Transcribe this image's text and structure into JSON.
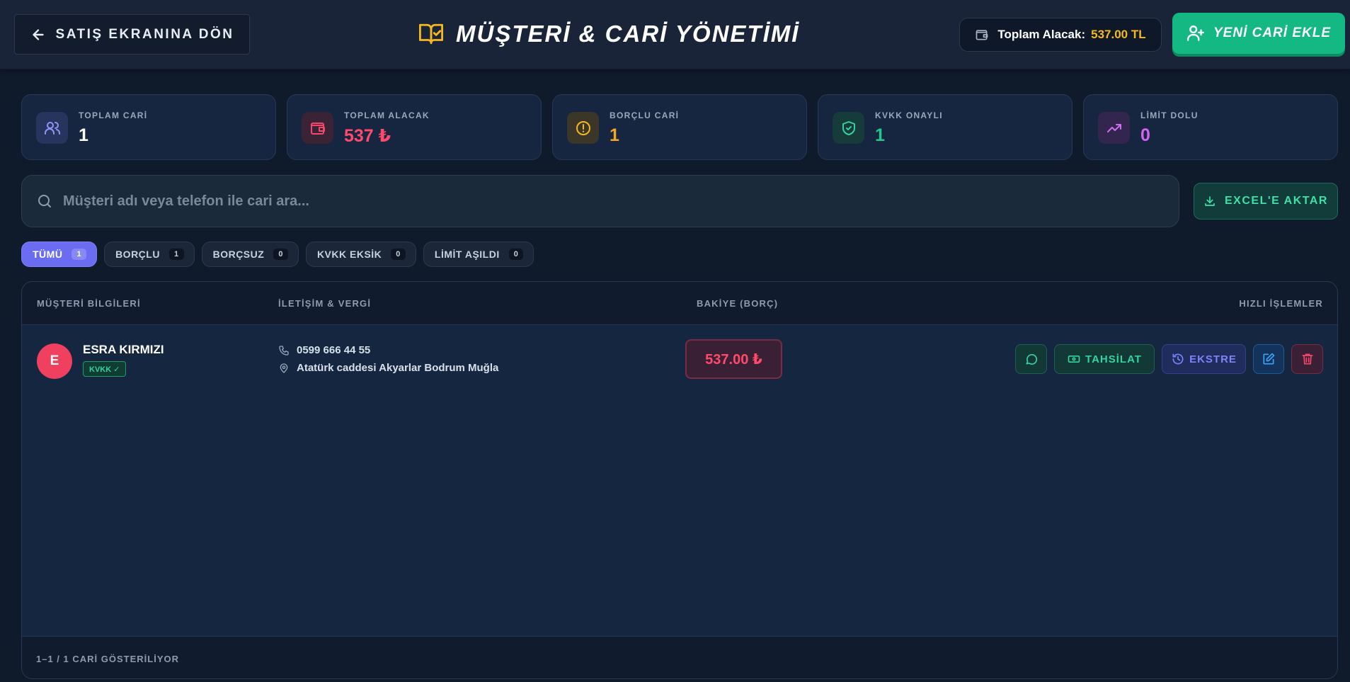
{
  "header": {
    "back_label": "SATIŞ EKRANINA DÖN",
    "title": "MÜŞTERİ & CARİ YÖNETİMİ",
    "total_label": "Toplam Alacak:",
    "total_value": "537.00 TL",
    "new_label": "YENİ CARİ EKLE"
  },
  "stats": [
    {
      "label": "TOPLAM CARİ",
      "value": "1",
      "color": "#ffffff",
      "icon": "users-icon",
      "icon_bg": "#27355e",
      "icon_color": "#8f96f6"
    },
    {
      "label": "TOPLAM ALACAK",
      "value": "537 ₺",
      "color": "#ff4a6b",
      "icon": "wallet-icon",
      "icon_bg": "#3b2336",
      "icon_color": "#f5476c"
    },
    {
      "label": "BORÇLU CARİ",
      "value": "1",
      "color": "#f5a623",
      "icon": "alert-circle-icon",
      "icon_bg": "#3a3628",
      "icon_color": "#f5b81f"
    },
    {
      "label": "KVKK ONAYLI",
      "value": "1",
      "color": "#20c98a",
      "icon": "shield-check-icon",
      "icon_bg": "#153c3a",
      "icon_color": "#34d39b"
    },
    {
      "label": "LİMİT DOLU",
      "value": "0",
      "color": "#d364f2",
      "icon": "trending-up-icon",
      "icon_bg": "#33264e",
      "icon_color": "#d26cf3"
    }
  ],
  "search": {
    "placeholder": "Müşteri adı veya telefon ile cari ara...",
    "value": ""
  },
  "excel_label": "EXCEL'E AKTAR",
  "filters": [
    {
      "label": "TÜMÜ",
      "count": "1",
      "active": true
    },
    {
      "label": "BORÇLU",
      "count": "1",
      "active": false
    },
    {
      "label": "BORÇSUZ",
      "count": "0",
      "active": false
    },
    {
      "label": "KVKK EKSİK",
      "count": "0",
      "active": false
    },
    {
      "label": "LİMİT AŞILDI",
      "count": "0",
      "active": false
    }
  ],
  "table": {
    "columns": [
      "MÜŞTERİ BİLGİLERİ",
      "İLETİŞİM & VERGİ",
      "BAKİYE (BORÇ)",
      "HIZLI İŞLEMLER"
    ],
    "rows": [
      {
        "initial": "E",
        "name": "ESRA KIRMIZI",
        "badge": "KVKK ✓",
        "phone": "0599 666 44 55",
        "address": "Atatürk caddesi Akyarlar Bodrum Muğla",
        "balance": "537.00 ₺",
        "tahsilat_label": "TAHSİLAT",
        "ekstre_label": "EKSTRE"
      }
    ],
    "footer": "1–1 / 1 CARİ GÖSTERİLİYOR"
  }
}
